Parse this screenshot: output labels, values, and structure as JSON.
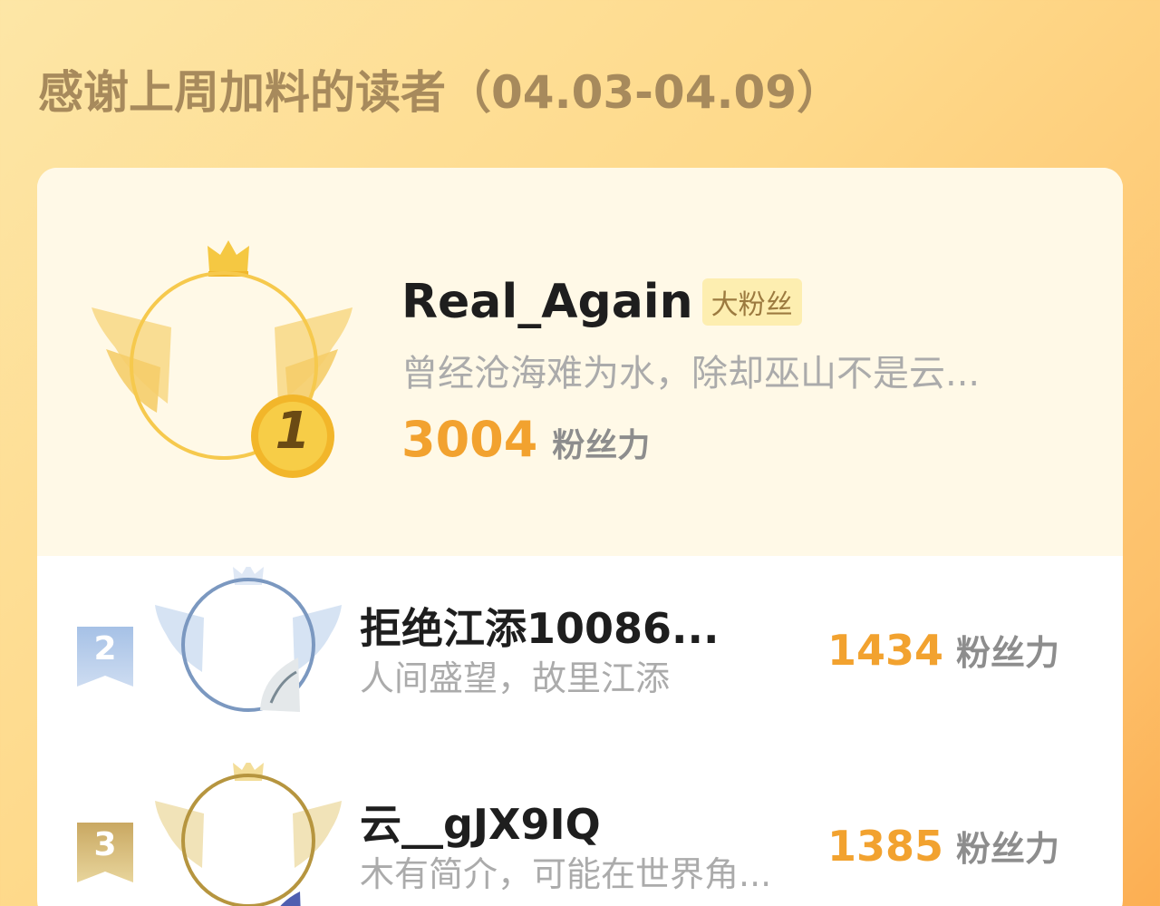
{
  "header": {
    "title": "感谢上周加料的读者（04.03-04.09）"
  },
  "colors": {
    "score": "#f2a22f",
    "gold_badge": "#f3c94a",
    "silver_badge": "#7b98c0",
    "bronze_badge": "#b6953f"
  },
  "readers": [
    {
      "rank": "1",
      "name": "Real_Again",
      "tag": "大粉丝",
      "bio": "曾经沧海难为水，除却巫山不是云...",
      "score": "3004",
      "score_unit": "粉丝力"
    },
    {
      "rank": "2",
      "name": "拒绝江添10086...",
      "bio": "人间盛望，故里江添",
      "score": "1434",
      "score_unit": "粉丝力"
    },
    {
      "rank": "3",
      "name": "云__gJX9IQ",
      "bio": "木有简介，可能在世界角...",
      "score": "1385",
      "score_unit": "粉丝力"
    }
  ]
}
